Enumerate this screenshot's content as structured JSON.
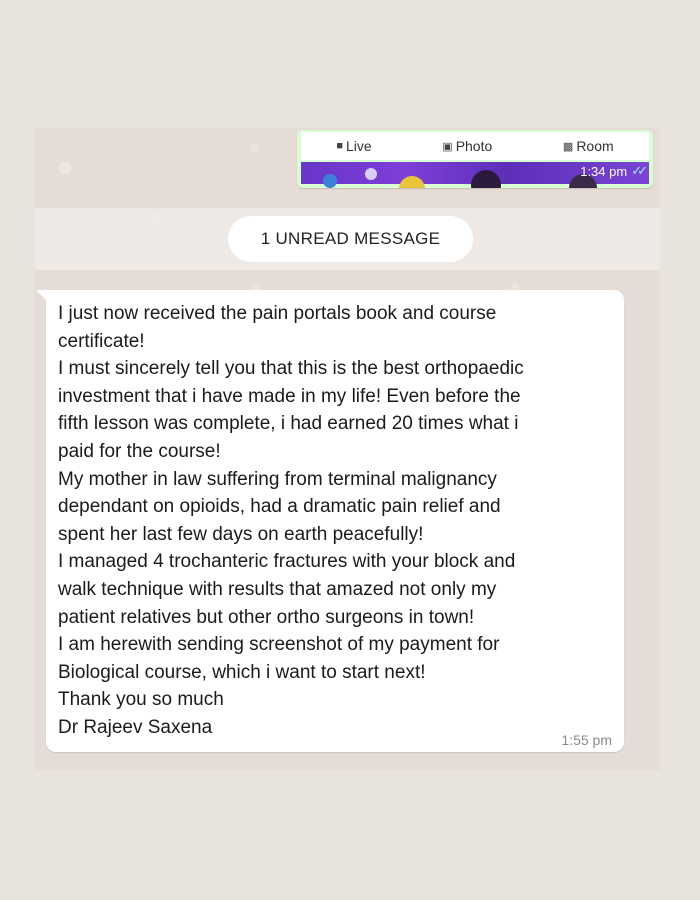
{
  "sent_message": {
    "tabs": [
      {
        "icon": "video-icon",
        "label": "Live"
      },
      {
        "icon": "photo-icon",
        "label": "Photo"
      },
      {
        "icon": "video-room-icon",
        "label": "Room"
      }
    ],
    "time": "1:34 pm",
    "status": "read"
  },
  "unread_divider": {
    "label": "1 UNREAD MESSAGE"
  },
  "received_message": {
    "lines": [
      "I just now received the pain portals book and course",
      "certificate!",
      "I must sincerely tell you that this is the best orthopaedic",
      "investment that i have made in my life! Even before the",
      "fifth lesson was complete, i had earned 20 times what i",
      "paid for the course!",
      "My mother in law suffering from terminal malignancy",
      "dependant on opioids, had a dramatic pain relief and",
      "spent her last few days on earth peacefully!",
      "I managed 4 trochanteric fractures with your block and",
      "walk technique with results that amazed not only my",
      "patient relatives but other ortho surgeons in town!",
      "I am herewith sending screenshot of my payment for",
      "Biological course, which i want to start next!",
      "Thank you so much",
      "Dr Rajeev Saxena"
    ],
    "time": "1:55 pm"
  },
  "colors": {
    "background": "#e8e3dd",
    "sent_bubble": "#d9fdd3",
    "received_bubble": "#ffffff",
    "read_ticks": "#9be7ff",
    "strip_purple": "#6a35c9"
  }
}
